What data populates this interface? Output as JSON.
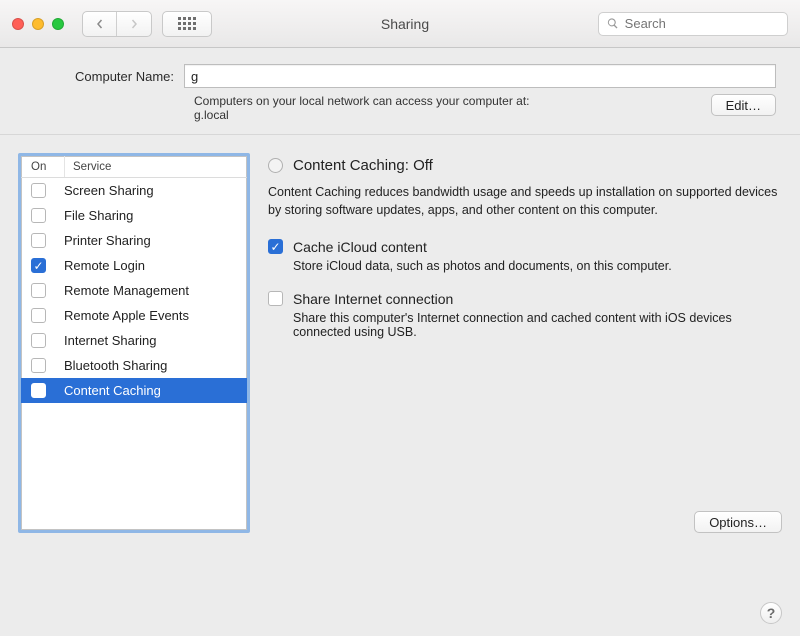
{
  "window_title": "Sharing",
  "search_placeholder": "Search",
  "computer_name": {
    "label": "Computer Name:",
    "value": "g",
    "hint_line1": "Computers on your local network can access your computer at:",
    "hint_line2": "g.local",
    "edit_label": "Edit…"
  },
  "list": {
    "col_on": "On",
    "col_service": "Service",
    "items": [
      {
        "label": "Screen Sharing",
        "on": false
      },
      {
        "label": "File Sharing",
        "on": false
      },
      {
        "label": "Printer Sharing",
        "on": false
      },
      {
        "label": "Remote Login",
        "on": true
      },
      {
        "label": "Remote Management",
        "on": false
      },
      {
        "label": "Remote Apple Events",
        "on": false
      },
      {
        "label": "Internet Sharing",
        "on": false
      },
      {
        "label": "Bluetooth Sharing",
        "on": false
      },
      {
        "label": "Content Caching",
        "on": false,
        "selected": true
      }
    ]
  },
  "detail": {
    "status": "Content Caching: Off",
    "description": "Content Caching reduces bandwidth usage and speeds up installation on supported devices by storing software updates, apps, and other content on this computer.",
    "opt_icloud": {
      "checked": true,
      "title": "Cache iCloud content",
      "sub": "Store iCloud data, such as photos and documents, on this computer."
    },
    "opt_share": {
      "checked": false,
      "title": "Share Internet connection",
      "sub": "Share this computer's Internet connection and cached content with iOS devices connected using USB."
    },
    "options_label": "Options…"
  },
  "help_label": "?"
}
